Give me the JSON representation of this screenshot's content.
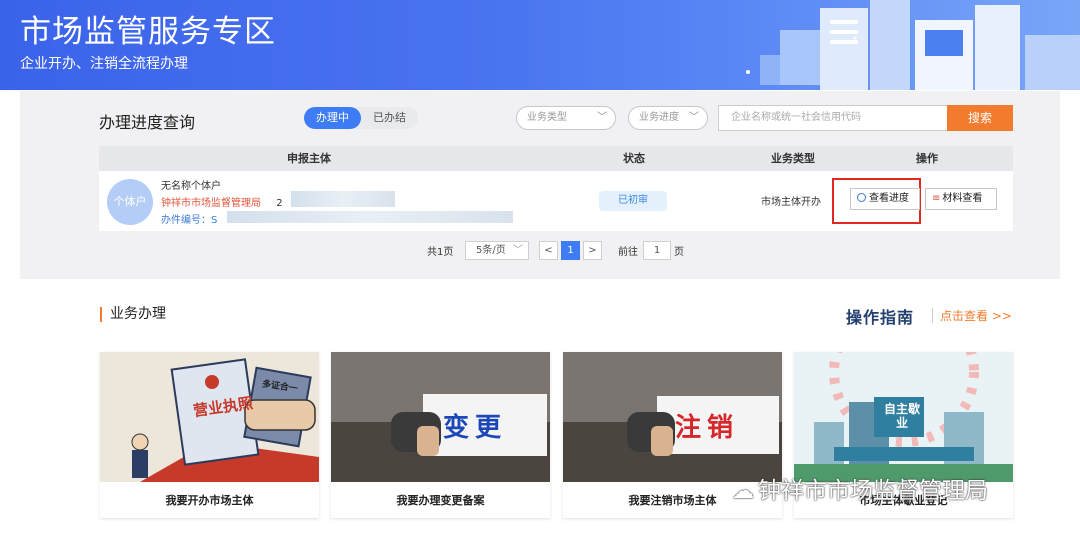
{
  "banner": {
    "title": "市场监管服务专区",
    "subtitle": "企业开办、注销全流程办理"
  },
  "progress": {
    "title": "办理进度查询",
    "tabs": [
      {
        "label": "办理中",
        "active": true
      },
      {
        "label": "已办结",
        "active": false
      }
    ],
    "filter_type_placeholder": "业务类型",
    "filter_progress_placeholder": "业务进度",
    "search_placeholder": "企业名称或统一社会信用代码",
    "search_button": "搜索",
    "columns": [
      "申报主体",
      "状态",
      "业务类型",
      "操作"
    ],
    "row": {
      "avatar_text": "个体户",
      "name": "无名称个体户",
      "org": "钟祥市市场监督管理局",
      "org_suffix": "2",
      "case_label": "办件编号：S",
      "status": "已初审",
      "biz_type": "市场主体开办",
      "btn_progress": "查看进度",
      "btn_material": "材料查看"
    },
    "pager": {
      "total": "共1页",
      "page_size": "5条/页",
      "prev": "<",
      "current": "1",
      "next": ">",
      "goto_label": "前往",
      "goto_value": "1",
      "page_suffix": "页"
    }
  },
  "business": {
    "title": "业务办理",
    "guide_title": "操作指南",
    "guide_link": "点击查看 >>",
    "cards": [
      {
        "caption": "我要开办市场主体",
        "sign": "营业执照",
        "tag": "多证合一"
      },
      {
        "caption": "我要办理变更备案",
        "sign": "变更"
      },
      {
        "caption": "我要注销市场主体",
        "sign": "注销"
      },
      {
        "caption": "市场主体歇业登记",
        "sign": "自主歇业"
      }
    ]
  },
  "watermark": "钟祥市市场监督管理局",
  "colors": {
    "primary": "#3d7cf5",
    "accent": "#f37b2d",
    "highlight": "#e0291f"
  }
}
